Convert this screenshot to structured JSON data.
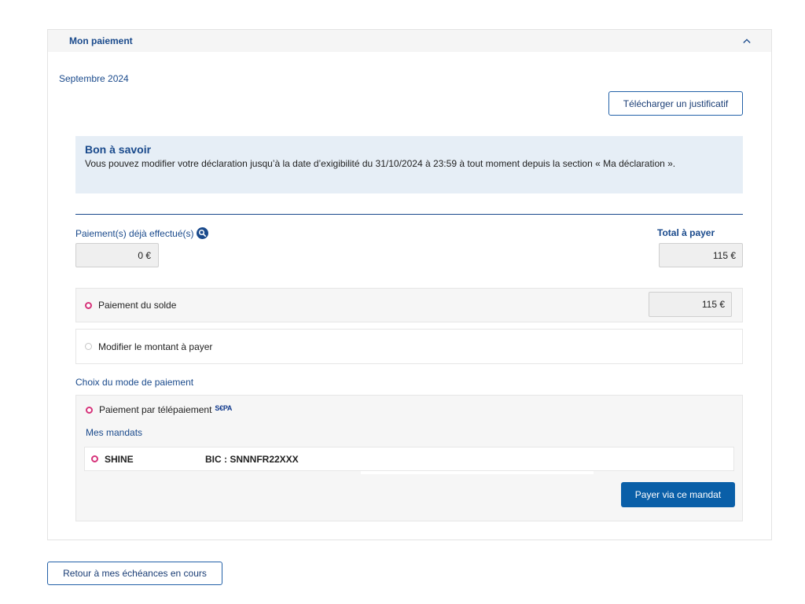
{
  "panel": {
    "title": "Mon paiement"
  },
  "month": "Septembre 2024",
  "download_button": "Télécharger un justificatif",
  "info": {
    "title": "Bon à savoir",
    "text": "Vous pouvez modifier votre déclaration jusqu’à la date d’exigibilité du 31/10/2024 à 23:59 à tout moment depuis la section « Ma déclaration »."
  },
  "payments": {
    "paid_label": "Paiement(s) déjà effectué(s)",
    "paid_value": "0 €",
    "total_label": "Total à payer",
    "total_value": "115 €"
  },
  "options": {
    "solde_label": "Paiement du solde",
    "solde_value": "115 €",
    "modify_label": "Modifier le montant à payer"
  },
  "mode": {
    "title": "Choix du mode de paiement",
    "option_label": "Paiement par télépaiement",
    "sepa_logo": "S€PA",
    "mandats_label": "Mes mandats",
    "mandate_name": "SHINE",
    "mandate_bic": "BIC : SNNNFR22XXX",
    "pay_button": "Payer via ce mandat"
  },
  "back_button": "Retour à mes échéances en cours",
  "colors": {
    "primary": "#1a4a8c",
    "accent_radio": "#d6337a",
    "button": "#0a5fa8",
    "info_bg": "#e6eef6"
  }
}
